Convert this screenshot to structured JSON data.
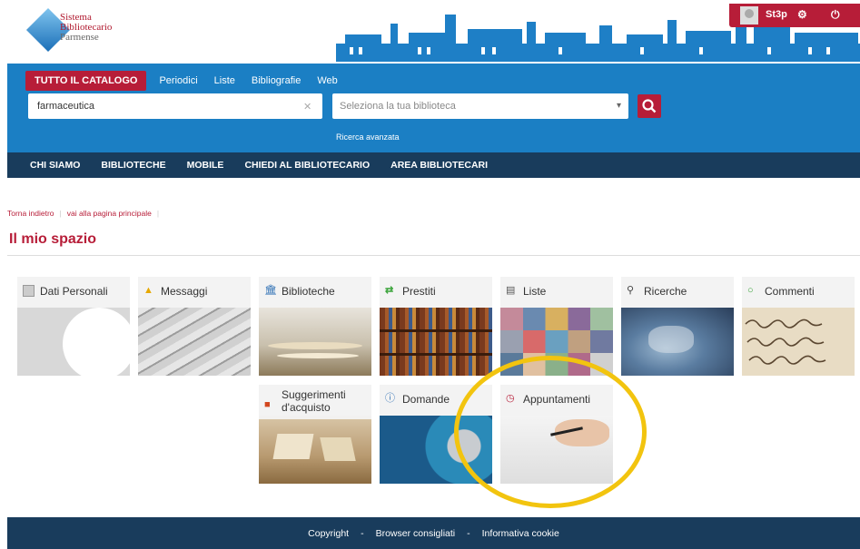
{
  "header": {
    "logo_lines": [
      "Sistema",
      "Bibliotecario",
      "Parmense"
    ],
    "username": "St3p"
  },
  "catalog": {
    "active_tab": "TUTTO IL CATALOGO",
    "tabs": [
      "Periodici",
      "Liste",
      "Bibliografie",
      "Web"
    ],
    "search_value": "farmaceutica",
    "library_placeholder": "Seleziona la tua biblioteca",
    "advanced_label": "Ricerca avanzata"
  },
  "nav": {
    "items": [
      "CHI SIAMO",
      "BIBLIOTECHE",
      "MOBILE",
      "CHIEDI AL BIBLIOTECARIO",
      "AREA BIBLIOTECARI"
    ]
  },
  "breadcrumb": {
    "back": "Torna indietro",
    "home": "vai alla pagina principale"
  },
  "page_title": "Il mio spazio",
  "tiles": [
    {
      "label": "Dati Personali",
      "icon": "user-icon"
    },
    {
      "label": "Messaggi",
      "icon": "bell-icon"
    },
    {
      "label": "Biblioteche",
      "icon": "library-icon"
    },
    {
      "label": "Prestiti",
      "icon": "exchange-icon"
    },
    {
      "label": "Liste",
      "icon": "list-icon"
    },
    {
      "label": "Ricerche",
      "icon": "search-icon"
    },
    {
      "label": "Commenti",
      "icon": "comment-icon"
    },
    {
      "label": "Suggerimenti d'acquisto",
      "icon": "gift-icon"
    },
    {
      "label": "Domande",
      "icon": "question-icon"
    },
    {
      "label": "Appuntamenti",
      "icon": "clock-icon"
    }
  ],
  "footer": {
    "links": [
      "Copyright",
      "Browser consigliati",
      "Informativa cookie"
    ]
  },
  "colors": {
    "brand_red": "#b71d38",
    "catalog_blue": "#1b7fc4",
    "nav_dark": "#193c5c",
    "highlight": "#f2c40f"
  }
}
